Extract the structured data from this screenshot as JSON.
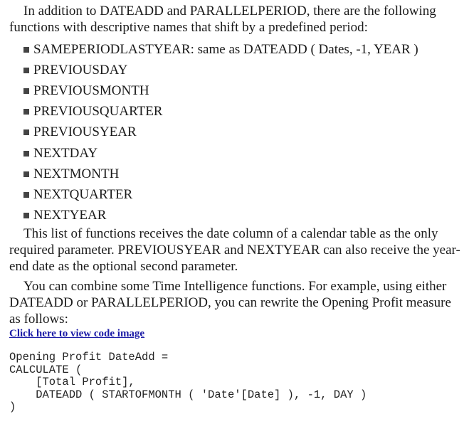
{
  "intro": {
    "text": "In addition to DATEADD and PARALLELPERIOD, there are the following functions with descriptive names that shift by a predefined period:"
  },
  "functions": [
    "SAMEPERIODLASTYEAR: same as DATEADD ( Dates, -1, YEAR )",
    "PREVIOUSDAY",
    "PREVIOUSMONTH",
    "PREVIOUSQUARTER",
    "PREVIOUSYEAR",
    "NEXTDAY",
    "NEXTMONTH",
    "NEXTQUARTER",
    "NEXTYEAR"
  ],
  "paragraph2": {
    "text": "This list of functions receives the date column of a calendar table as the only required parameter. PREVIOUSYEAR and NEXTYEAR can also receive the year-end date as the optional second parameter."
  },
  "paragraph3": {
    "text": "You can combine some Time Intelligence functions. For example, using either DATEADD or PARALLELPERIOD, you can rewrite the Opening Profit measure as follows:"
  },
  "code_link": {
    "label": "Click here to view code image"
  },
  "code": {
    "text": "Opening Profit DateAdd =\nCALCULATE (\n    [Total Profit],\n    DATEADD ( STARTOFMONTH ( 'Date'[Date] ), -1, DAY )\n)"
  }
}
